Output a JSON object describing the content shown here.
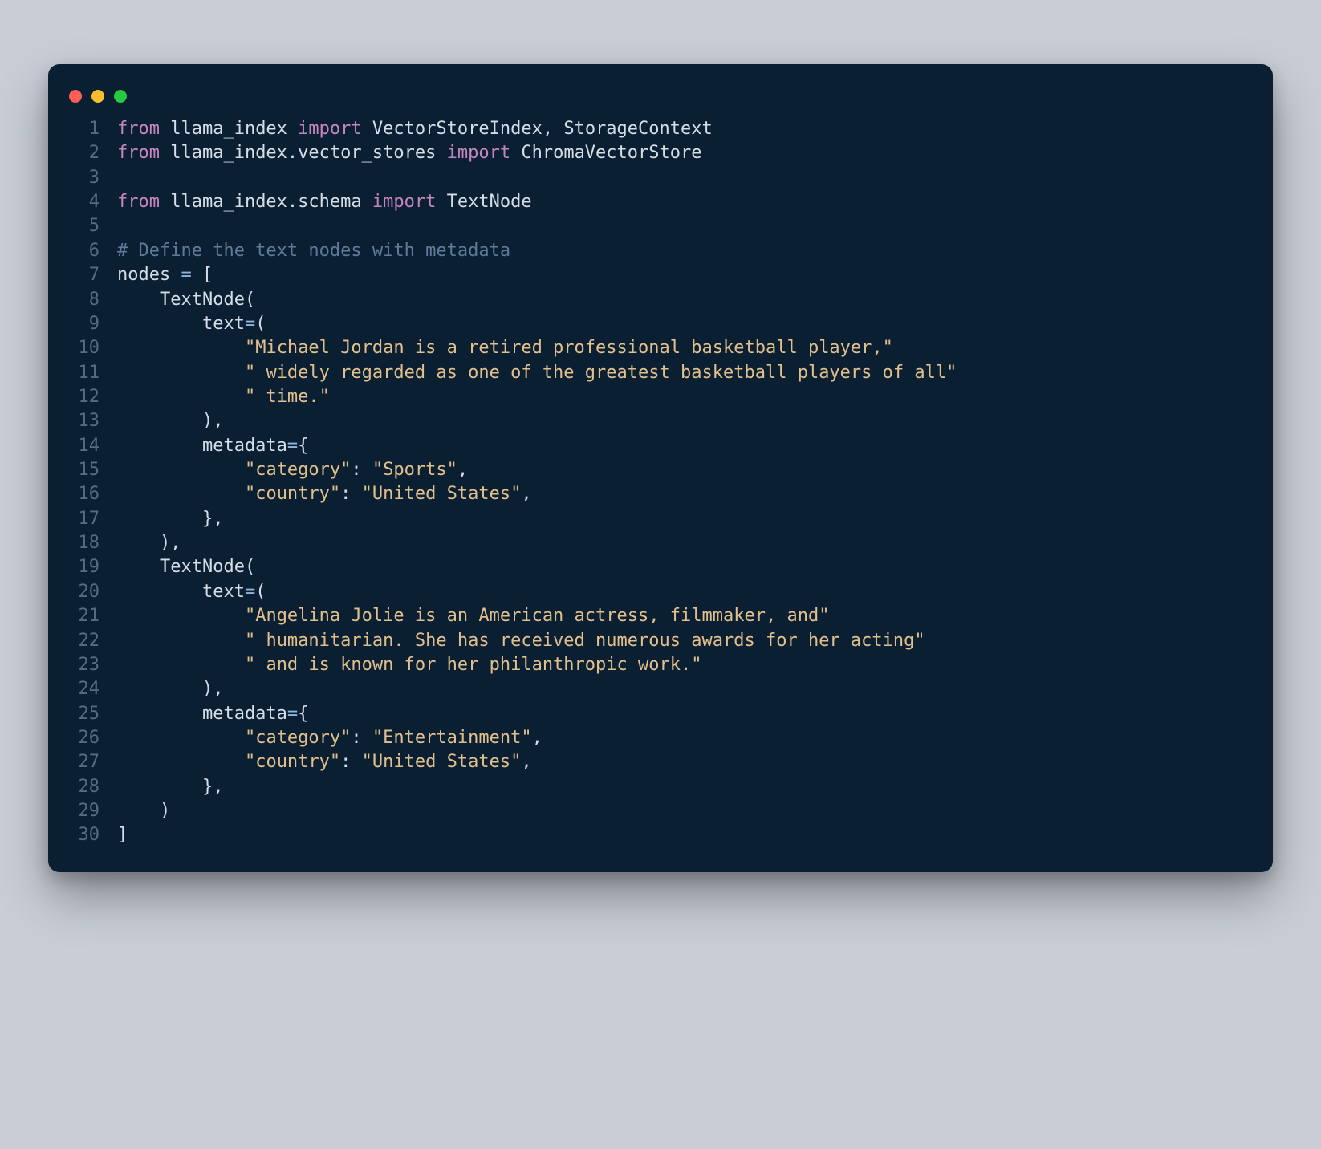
{
  "window": {
    "traffic": [
      "close",
      "minimize",
      "zoom"
    ]
  },
  "code": {
    "lines": [
      {
        "n": "1",
        "seg": [
          {
            "c": "kw",
            "t": "from"
          },
          {
            "c": "id",
            "t": " llama_index "
          },
          {
            "c": "kw",
            "t": "import"
          },
          {
            "c": "id",
            "t": " VectorStoreIndex"
          },
          {
            "c": "pun",
            "t": ", "
          },
          {
            "c": "id",
            "t": "StorageContext"
          }
        ]
      },
      {
        "n": "2",
        "seg": [
          {
            "c": "kw",
            "t": "from"
          },
          {
            "c": "id",
            "t": " llama_index.vector_stores "
          },
          {
            "c": "kw",
            "t": "import"
          },
          {
            "c": "id",
            "t": " ChromaVectorStore"
          }
        ]
      },
      {
        "n": "3",
        "seg": []
      },
      {
        "n": "4",
        "seg": [
          {
            "c": "kw",
            "t": "from"
          },
          {
            "c": "id",
            "t": " llama_index.schema "
          },
          {
            "c": "kw",
            "t": "import"
          },
          {
            "c": "id",
            "t": " TextNode"
          }
        ]
      },
      {
        "n": "5",
        "seg": []
      },
      {
        "n": "6",
        "seg": [
          {
            "c": "com",
            "t": "# Define the text nodes with metadata"
          }
        ]
      },
      {
        "n": "7",
        "seg": [
          {
            "c": "id",
            "t": "nodes "
          },
          {
            "c": "op",
            "t": "="
          },
          {
            "c": "id",
            "t": " "
          },
          {
            "c": "pun",
            "t": "["
          }
        ]
      },
      {
        "n": "8",
        "seg": [
          {
            "c": "id",
            "t": "    TextNode"
          },
          {
            "c": "pun",
            "t": "("
          }
        ]
      },
      {
        "n": "9",
        "seg": [
          {
            "c": "id",
            "t": "        text"
          },
          {
            "c": "op",
            "t": "="
          },
          {
            "c": "pun",
            "t": "("
          }
        ]
      },
      {
        "n": "10",
        "seg": [
          {
            "c": "id",
            "t": "            "
          },
          {
            "c": "str",
            "t": "\"Michael Jordan is a retired professional basketball player,\""
          }
        ]
      },
      {
        "n": "11",
        "seg": [
          {
            "c": "id",
            "t": "            "
          },
          {
            "c": "str",
            "t": "\" widely regarded as one of the greatest basketball players of all\""
          }
        ]
      },
      {
        "n": "12",
        "seg": [
          {
            "c": "id",
            "t": "            "
          },
          {
            "c": "str",
            "t": "\" time.\""
          }
        ]
      },
      {
        "n": "13",
        "seg": [
          {
            "c": "id",
            "t": "        "
          },
          {
            "c": "pun",
            "t": ")"
          },
          {
            "c": "pun",
            "t": ","
          }
        ]
      },
      {
        "n": "14",
        "seg": [
          {
            "c": "id",
            "t": "        metadata"
          },
          {
            "c": "op",
            "t": "="
          },
          {
            "c": "pun",
            "t": "{"
          }
        ]
      },
      {
        "n": "15",
        "seg": [
          {
            "c": "id",
            "t": "            "
          },
          {
            "c": "str",
            "t": "\"category\""
          },
          {
            "c": "pun",
            "t": ": "
          },
          {
            "c": "str",
            "t": "\"Sports\""
          },
          {
            "c": "pun",
            "t": ","
          }
        ]
      },
      {
        "n": "16",
        "seg": [
          {
            "c": "id",
            "t": "            "
          },
          {
            "c": "str",
            "t": "\"country\""
          },
          {
            "c": "pun",
            "t": ": "
          },
          {
            "c": "str",
            "t": "\"United States\""
          },
          {
            "c": "pun",
            "t": ","
          }
        ]
      },
      {
        "n": "17",
        "seg": [
          {
            "c": "id",
            "t": "        "
          },
          {
            "c": "pun",
            "t": "}"
          },
          {
            "c": "pun",
            "t": ","
          }
        ]
      },
      {
        "n": "18",
        "seg": [
          {
            "c": "id",
            "t": "    "
          },
          {
            "c": "pun",
            "t": ")"
          },
          {
            "c": "pun",
            "t": ","
          }
        ]
      },
      {
        "n": "19",
        "seg": [
          {
            "c": "id",
            "t": "    TextNode"
          },
          {
            "c": "pun",
            "t": "("
          }
        ]
      },
      {
        "n": "20",
        "seg": [
          {
            "c": "id",
            "t": "        text"
          },
          {
            "c": "op",
            "t": "="
          },
          {
            "c": "pun",
            "t": "("
          }
        ]
      },
      {
        "n": "21",
        "seg": [
          {
            "c": "id",
            "t": "            "
          },
          {
            "c": "str",
            "t": "\"Angelina Jolie is an American actress, filmmaker, and\""
          }
        ]
      },
      {
        "n": "22",
        "seg": [
          {
            "c": "id",
            "t": "            "
          },
          {
            "c": "str",
            "t": "\" humanitarian. She has received numerous awards for her acting\""
          }
        ]
      },
      {
        "n": "23",
        "seg": [
          {
            "c": "id",
            "t": "            "
          },
          {
            "c": "str",
            "t": "\" and is known for her philanthropic work.\""
          }
        ]
      },
      {
        "n": "24",
        "seg": [
          {
            "c": "id",
            "t": "        "
          },
          {
            "c": "pun",
            "t": ")"
          },
          {
            "c": "pun",
            "t": ","
          }
        ]
      },
      {
        "n": "25",
        "seg": [
          {
            "c": "id",
            "t": "        metadata"
          },
          {
            "c": "op",
            "t": "="
          },
          {
            "c": "pun",
            "t": "{"
          }
        ]
      },
      {
        "n": "26",
        "seg": [
          {
            "c": "id",
            "t": "            "
          },
          {
            "c": "str",
            "t": "\"category\""
          },
          {
            "c": "pun",
            "t": ": "
          },
          {
            "c": "str",
            "t": "\"Entertainment\""
          },
          {
            "c": "pun",
            "t": ","
          }
        ]
      },
      {
        "n": "27",
        "seg": [
          {
            "c": "id",
            "t": "            "
          },
          {
            "c": "str",
            "t": "\"country\""
          },
          {
            "c": "pun",
            "t": ": "
          },
          {
            "c": "str",
            "t": "\"United States\""
          },
          {
            "c": "pun",
            "t": ","
          }
        ]
      },
      {
        "n": "28",
        "seg": [
          {
            "c": "id",
            "t": "        "
          },
          {
            "c": "pun",
            "t": "}"
          },
          {
            "c": "pun",
            "t": ","
          }
        ]
      },
      {
        "n": "29",
        "seg": [
          {
            "c": "id",
            "t": "    "
          },
          {
            "c": "pun",
            "t": ")"
          }
        ]
      },
      {
        "n": "30",
        "seg": [
          {
            "c": "pun",
            "t": "]"
          }
        ]
      }
    ]
  }
}
